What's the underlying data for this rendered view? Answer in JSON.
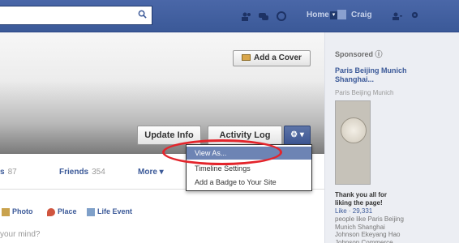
{
  "topbar": {
    "search_placeholder": "",
    "nav_links": [
      "Home",
      "Craig"
    ]
  },
  "cover": {
    "add_cover_label": "Add a Cover",
    "update_info_label": "Update Info",
    "activity_log_label": "Activity Log",
    "gear_label": "⚙ ▾"
  },
  "tabs": [
    {
      "label": "s",
      "count": "87"
    },
    {
      "label": "Friends",
      "count": "354"
    },
    {
      "label": "More ▾",
      "count": ""
    }
  ],
  "dropdown": {
    "items": [
      "View As...",
      "Timeline Settings",
      "Add a Badge to Your Site"
    ]
  },
  "composer": {
    "items": [
      "Photo",
      "Place",
      "Life Event"
    ],
    "prompt": "your mind?"
  },
  "sidebar": {
    "sponsored": "Sponsored ⓘ",
    "ad_title": "Paris Beijing Munich Shanghai...",
    "ad_url": "Paris Beijing Munich",
    "ad_body": "Thank you all for liking the page!",
    "like_text": "Like · 29,331",
    "people_text": "people like Paris Beijing Munich Shanghai Johnson Ekeyang Hao Johnson Commerce Group"
  },
  "colors": {
    "brand": "#3b5998",
    "annotation": "#e3242b"
  }
}
